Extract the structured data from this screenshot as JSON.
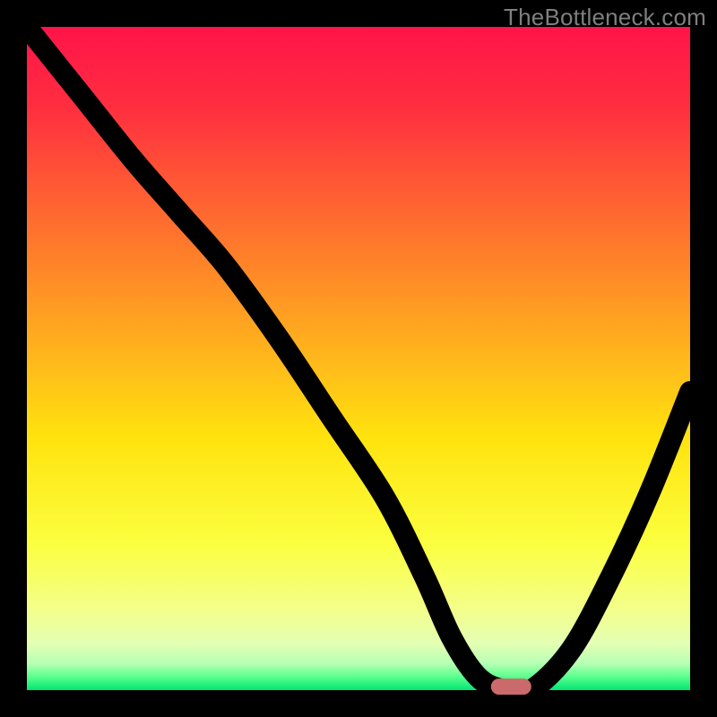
{
  "watermark": "TheBottleneck.com",
  "colors": {
    "frame": "#000000",
    "curve": "#000000",
    "marker": "#cb6a6b"
  },
  "chart_data": {
    "type": "line",
    "title": "",
    "xlabel": "",
    "ylabel": "",
    "xlim": [
      0,
      100
    ],
    "ylim": [
      0,
      100
    ],
    "x": [
      0,
      8,
      16,
      23,
      30,
      38,
      46,
      54,
      60,
      64,
      68,
      72,
      76,
      82,
      88,
      94,
      100
    ],
    "values": [
      100,
      90,
      80,
      72,
      64,
      53,
      41,
      29,
      17,
      8,
      2,
      0,
      0,
      6,
      17,
      30,
      45
    ],
    "marker": {
      "x": 73,
      "y": 0,
      "w": 6,
      "h": 2.4
    },
    "gradient_stops": [
      {
        "pct": 0,
        "color": "#ff1449"
      },
      {
        "pct": 12,
        "color": "#ff2e3f"
      },
      {
        "pct": 30,
        "color": "#ff6f2e"
      },
      {
        "pct": 48,
        "color": "#ffb01d"
      },
      {
        "pct": 62,
        "color": "#ffe30e"
      },
      {
        "pct": 78,
        "color": "#fbff3f"
      },
      {
        "pct": 88,
        "color": "#f3ff8c"
      },
      {
        "pct": 93,
        "color": "#e4ffb4"
      },
      {
        "pct": 96,
        "color": "#b6ffb4"
      },
      {
        "pct": 98,
        "color": "#5aff8c"
      },
      {
        "pct": 100,
        "color": "#00e676"
      }
    ]
  }
}
